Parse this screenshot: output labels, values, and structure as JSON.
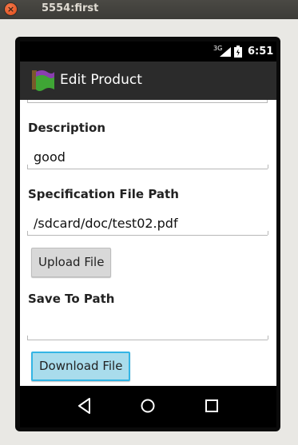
{
  "window": {
    "title": "5554:first",
    "close_glyph": "×"
  },
  "statusbar": {
    "network": "3G",
    "time": "6:51",
    "icons": [
      "signal-icon",
      "battery-icon"
    ]
  },
  "actionbar": {
    "title": "Edit Product",
    "icon": "app-icon"
  },
  "form": {
    "description": {
      "label": "Description",
      "value": "good"
    },
    "spec_path": {
      "label": "Specification File Path",
      "value": "/sdcard/doc/test02.pdf"
    },
    "upload_button": "Upload File",
    "save_path": {
      "label": "Save To Path",
      "value": ""
    },
    "download_button": "Download File"
  },
  "navbar": {
    "icons": [
      "back-icon",
      "home-icon",
      "recents-icon"
    ]
  },
  "colors": {
    "accent": "#33b5e5",
    "titlebar": "#3c3b37",
    "close": "#e04a17"
  }
}
